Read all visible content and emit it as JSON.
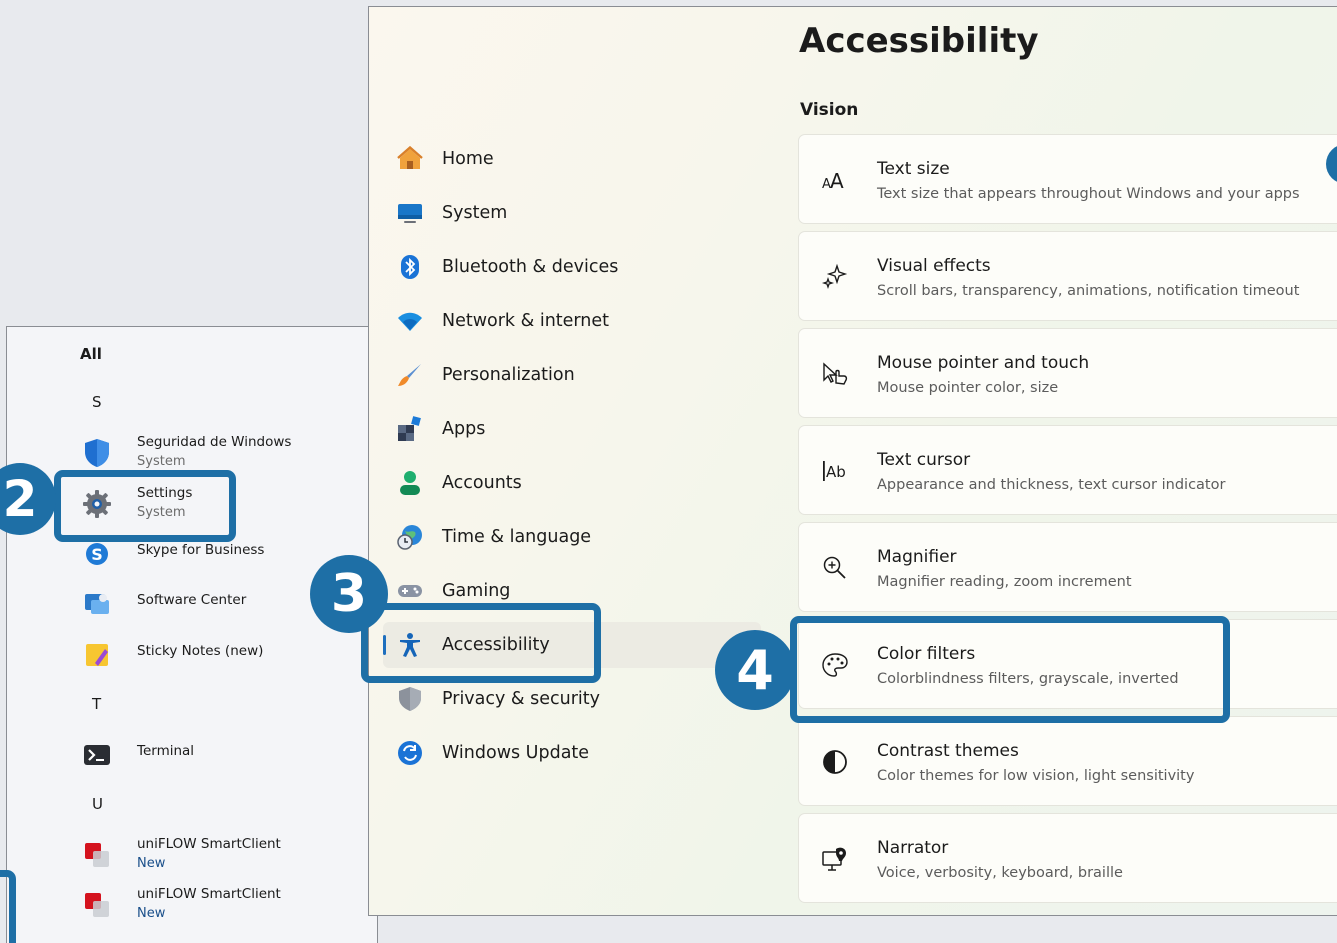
{
  "start_menu": {
    "header": "All",
    "letters": [
      "S",
      "T",
      "U"
    ],
    "apps": [
      {
        "name": "Seguridad de Windows",
        "sub": "System"
      },
      {
        "name": "Settings",
        "sub": "System"
      },
      {
        "name": "Skype for Business",
        "sub": ""
      },
      {
        "name": "Software Center",
        "sub": ""
      },
      {
        "name": "Sticky Notes (new)",
        "sub": ""
      },
      {
        "name": "Terminal",
        "sub": ""
      },
      {
        "name": "uniFLOW SmartClient",
        "sub": "New"
      },
      {
        "name": "uniFLOW SmartClient",
        "sub": "New"
      }
    ]
  },
  "settings": {
    "nav": [
      {
        "label": "Home",
        "icon": "home-icon"
      },
      {
        "label": "System",
        "icon": "monitor-icon"
      },
      {
        "label": "Bluetooth & devices",
        "icon": "bluetooth-icon"
      },
      {
        "label": "Network & internet",
        "icon": "wifi-icon"
      },
      {
        "label": "Personalization",
        "icon": "brush-icon"
      },
      {
        "label": "Apps",
        "icon": "apps-icon"
      },
      {
        "label": "Accounts",
        "icon": "person-icon"
      },
      {
        "label": "Time & language",
        "icon": "globe-clock-icon"
      },
      {
        "label": "Gaming",
        "icon": "gamepad-icon"
      },
      {
        "label": "Accessibility",
        "icon": "accessibility-icon"
      },
      {
        "label": "Privacy & security",
        "icon": "shield-icon"
      },
      {
        "label": "Windows Update",
        "icon": "update-icon"
      }
    ],
    "selected_nav": "Accessibility",
    "page_title": "Accessibility",
    "section": "Vision",
    "cards": [
      {
        "title": "Text size",
        "desc": "Text size that appears throughout Windows and your apps",
        "icon": "text-size-icon"
      },
      {
        "title": "Visual effects",
        "desc": "Scroll bars, transparency, animations, notification timeout",
        "icon": "sparkle-icon"
      },
      {
        "title": "Mouse pointer and touch",
        "desc": "Mouse pointer color, size",
        "icon": "pointer-touch-icon"
      },
      {
        "title": "Text cursor",
        "desc": "Appearance and thickness, text cursor indicator",
        "icon": "text-cursor-icon"
      },
      {
        "title": "Magnifier",
        "desc": "Magnifier reading, zoom increment",
        "icon": "magnifier-icon"
      },
      {
        "title": "Color filters",
        "desc": "Colorblindness filters, grayscale, inverted",
        "icon": "palette-icon"
      },
      {
        "title": "Contrast themes",
        "desc": "Color themes for low vision, light sensitivity",
        "icon": "contrast-icon"
      },
      {
        "title": "Narrator",
        "desc": "Voice, verbosity, keyboard, braille",
        "icon": "narrator-icon"
      }
    ]
  },
  "annotations": {
    "steps": [
      "2",
      "3",
      "4"
    ],
    "color": "#1e6fa6"
  },
  "colors": {
    "accent": "#1e6fbe",
    "window_bg": "#f7f6ec",
    "card_bg": "#fdfdf9"
  }
}
